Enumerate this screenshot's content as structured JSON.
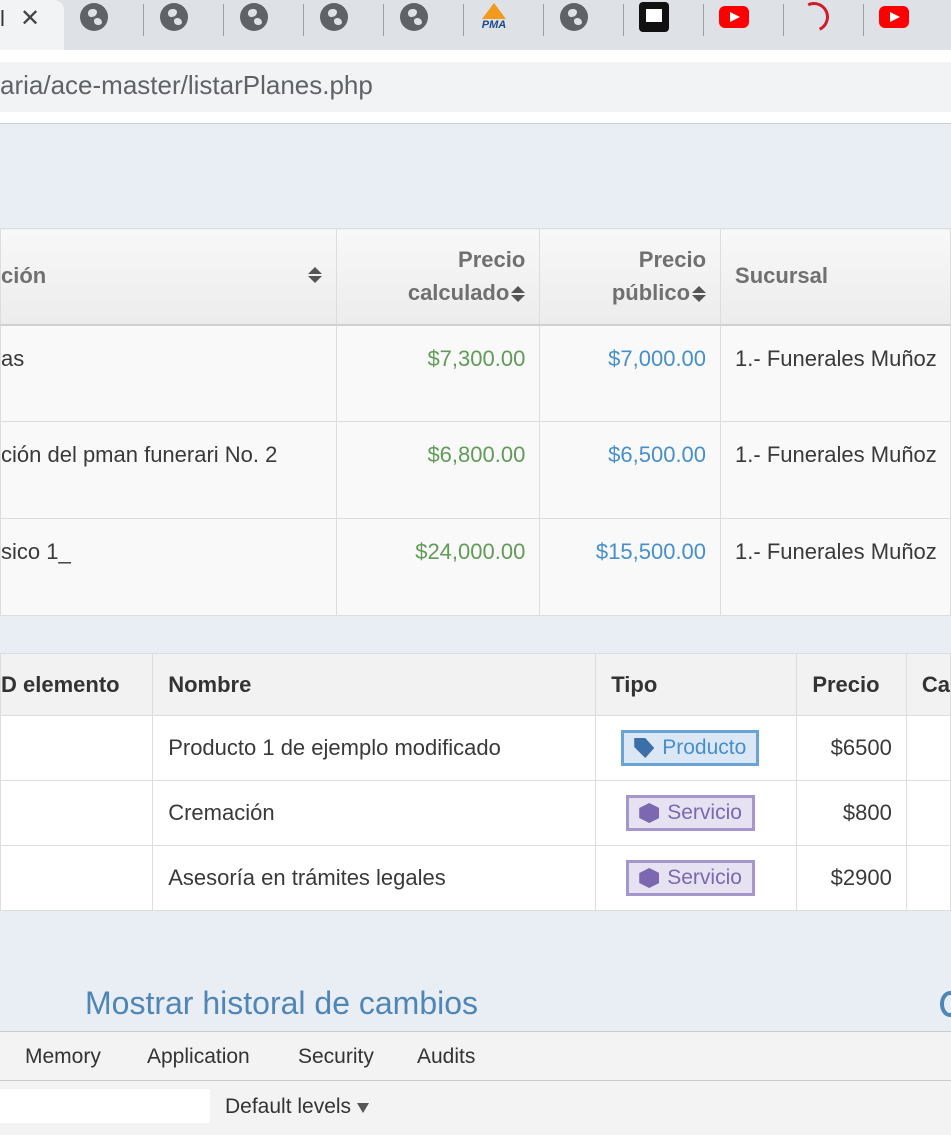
{
  "browser": {
    "active_tab": {
      "title": "l",
      "close": "✕"
    },
    "tabs": [
      {
        "icon": "globe-icon"
      },
      {
        "icon": "globe-icon"
      },
      {
        "icon": "globe-icon"
      },
      {
        "icon": "globe-icon"
      },
      {
        "icon": "globe-icon"
      },
      {
        "icon": "phpmyadmin-icon",
        "label": "PMA"
      },
      {
        "icon": "globe-icon"
      },
      {
        "icon": "flag-icon"
      },
      {
        "icon": "youtube-icon"
      },
      {
        "icon": "swirl-icon"
      },
      {
        "icon": "youtube-icon"
      }
    ],
    "url": "aria/ace-master/listarPlanes.php"
  },
  "plans_table": {
    "headers": {
      "description": "ción",
      "calc_price_1": "Precio",
      "calc_price_2": "calculado",
      "public_price_1": "Precio",
      "public_price_2": "público",
      "branch": "Sucursal"
    },
    "rows": [
      {
        "description": "as",
        "calc_price": "$7,300.00",
        "public_price": "$7,000.00",
        "branch": "1.- Funerales Muñoz"
      },
      {
        "description": "ción del pman funerari No. 2",
        "calc_price": "$6,800.00",
        "public_price": "$6,500.00",
        "branch": "1.- Funerales Muñoz"
      },
      {
        "description": "sico 1_",
        "calc_price": "$24,000.00",
        "public_price": "$15,500.00",
        "branch": "1.- Funerales Muñoz"
      }
    ]
  },
  "items_table": {
    "headers": {
      "id": "D elemento",
      "name": "Nombre",
      "type": "Tipo",
      "price": "Precio",
      "extra": "Ca"
    },
    "rows": [
      {
        "name": "Producto 1 de ejemplo modificado",
        "type": "Producto",
        "type_icon": "tag-icon",
        "price": "$6500"
      },
      {
        "name": "Cremación",
        "type": "Servicio",
        "type_icon": "cube-icon",
        "price": "$800"
      },
      {
        "name": "Asesoría en trámites legales",
        "type": "Servicio",
        "type_icon": "cube-icon",
        "price": "$2900"
      }
    ]
  },
  "history_link": "Mostrar historal de cambios",
  "devtools": {
    "tabs": [
      "Memory",
      "Application",
      "Security",
      "Audits"
    ],
    "levels": "Default levels"
  },
  "colors": {
    "calc_price": "#629b58",
    "public_price": "#478fca",
    "link": "#4f86b5",
    "page_bg": "#e9eef5"
  }
}
